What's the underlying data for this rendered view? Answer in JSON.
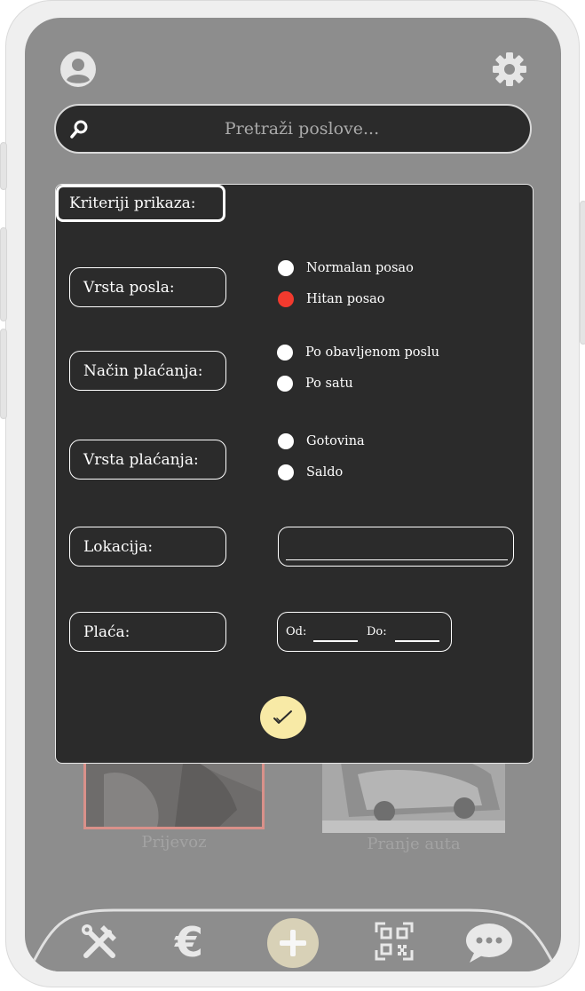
{
  "search": {
    "placeholder": "Pretraži poslove..."
  },
  "filter_panel": {
    "title": "Kriteriji prikaza:",
    "job_type": {
      "label": "Vrsta posla:",
      "options": [
        {
          "label": "Normalan posao",
          "selected": false
        },
        {
          "label": "Hitan posao",
          "selected": true
        }
      ]
    },
    "payment_method": {
      "label": "Način plaćanja:",
      "options": [
        {
          "label": "Po obavljenom poslu",
          "selected": false
        },
        {
          "label": "Po satu",
          "selected": false
        }
      ]
    },
    "payment_type": {
      "label": "Vrsta plaćanja:",
      "options": [
        {
          "label": "Gotovina",
          "selected": false
        },
        {
          "label": "Saldo",
          "selected": false
        }
      ]
    },
    "location": {
      "label": "Lokacija:",
      "value": ""
    },
    "salary": {
      "label": "Plaća:",
      "from_label": "Od:",
      "to_label": "Do:",
      "from_value": "",
      "to_value": ""
    }
  },
  "background_cards": [
    {
      "caption": "Prijevoz"
    },
    {
      "caption": "Pranje auta"
    }
  ],
  "colors": {
    "selected_radio": "#f23a2e",
    "confirm_button": "#f8eaa6",
    "panel_bg": "#2b2b2b",
    "overlay": "#8d8d8d"
  },
  "nav": {
    "items": [
      "tools-icon",
      "euro-icon",
      "add-icon",
      "qr-code-icon",
      "chat-icon"
    ]
  }
}
